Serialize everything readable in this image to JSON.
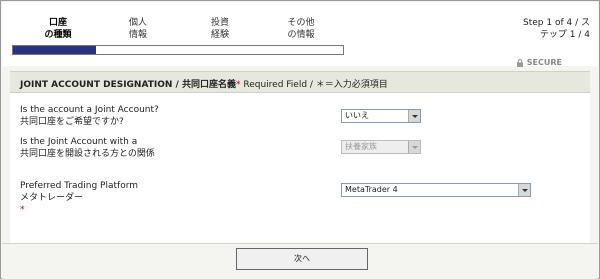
{
  "steps": [
    {
      "line1": "口座",
      "line2": "の種類",
      "active": true
    },
    {
      "line1": "個人",
      "line2": "情報",
      "active": false
    },
    {
      "line1": "投資",
      "line2": "経験",
      "active": false
    },
    {
      "line1": "その他",
      "line2": "の情報",
      "active": false
    }
  ],
  "step_counter": {
    "line1": "Step 1 of 4 / ス",
    "line2": "テップ 1 / 4"
  },
  "progress": {
    "fraction": 0.25,
    "fill_color": "#2a3380"
  },
  "secure_label": "SECURE",
  "section": {
    "title": "JOINT ACCOUNT DESIGNATION / 共同口座名義",
    "required_star": "*",
    "required_text": " Required Field / ＊＝入力必須項目"
  },
  "fields": {
    "joint": {
      "label_en": "Is the account a Joint Account?",
      "label_jp": "共同口座をご希望ですか?",
      "value": "いいえ"
    },
    "relation": {
      "label_en": "Is the Joint Account with a",
      "label_jp": "共同口座を開設される方との関係",
      "value": "扶養家族"
    },
    "platform": {
      "label_en": "Preferred Trading Platform",
      "label_jp": "メタトレーダー",
      "required_star": "*",
      "value": "MetaTrader 4"
    }
  },
  "next_label": "次へ"
}
